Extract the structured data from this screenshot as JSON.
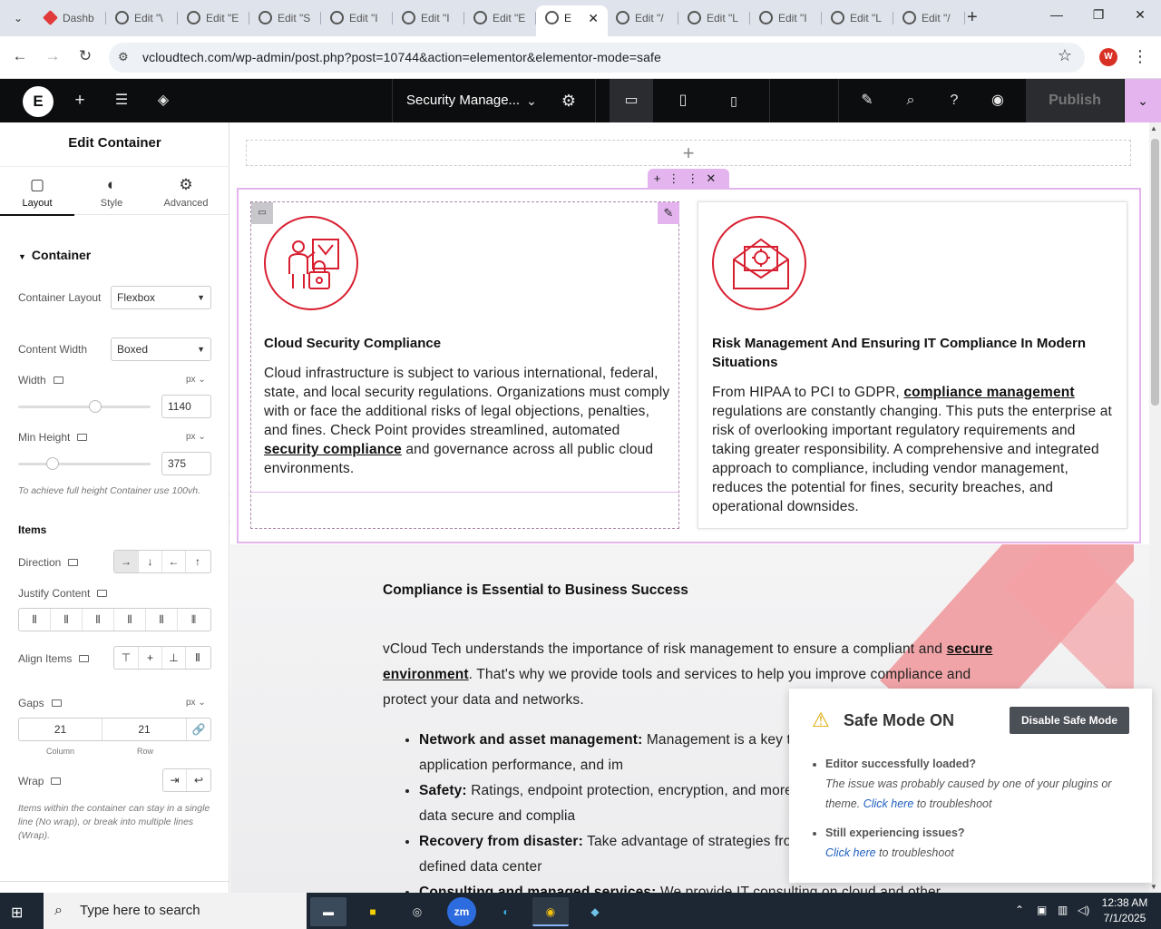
{
  "browser": {
    "tabs": [
      {
        "label": "Dashb",
        "icon": "wordpress-ruby-icon"
      },
      {
        "label": "Edit \"\\",
        "icon": "wordpress-icon"
      },
      {
        "label": "Edit \"E",
        "icon": "wordpress-icon"
      },
      {
        "label": "Edit \"S",
        "icon": "wordpress-icon"
      },
      {
        "label": "Edit \"I",
        "icon": "wordpress-icon"
      },
      {
        "label": "Edit \"I",
        "icon": "wordpress-icon"
      },
      {
        "label": "Edit \"E",
        "icon": "wordpress-icon"
      },
      {
        "label": "E",
        "icon": "wordpress-icon",
        "active": true
      },
      {
        "label": "Edit \"/",
        "icon": "wordpress-icon"
      },
      {
        "label": "Edit \"L",
        "icon": "wordpress-icon"
      },
      {
        "label": "Edit \"I",
        "icon": "wordpress-icon"
      },
      {
        "label": "Edit \"L",
        "icon": "wordpress-icon"
      },
      {
        "label": "Edit \"/",
        "icon": "wordpress-icon"
      }
    ],
    "url": "vcloudtech.com/wp-admin/post.php?post=10744&action=elementor&elementor-mode=safe",
    "profile_initial": "W"
  },
  "elementor": {
    "page_title": "Security Manage...",
    "publish_label": "Publish"
  },
  "panel": {
    "title": "Edit Container",
    "tabs": {
      "layout": "Layout",
      "style": "Style",
      "advanced": "Advanced"
    },
    "section": "Container",
    "container_layout": {
      "label": "Container Layout",
      "value": "Flexbox"
    },
    "content_width": {
      "label": "Content Width",
      "value": "Boxed"
    },
    "width": {
      "label": "Width",
      "unit": "px",
      "value": "1140"
    },
    "min_height": {
      "label": "Min Height",
      "unit": "px",
      "value": "375"
    },
    "min_height_hint": "To achieve full height Container use 100vh.",
    "items_heading": "Items",
    "direction_label": "Direction",
    "justify_label": "Justify Content",
    "align_label": "Align Items",
    "gaps": {
      "label": "Gaps",
      "unit": "px",
      "column": "21",
      "row": "21",
      "column_label": "Column",
      "row_label": "Row"
    },
    "wrap_label": "Wrap",
    "wrap_hint": "Items within the container can stay in a single line (No wrap), or break into multiple lines (Wrap)."
  },
  "canvas": {
    "card1": {
      "title": "Cloud Security Compliance",
      "text_before": "Cloud infrastructure is subject to various international, federal, state, and local security regulations. Organizations must comply with or face the additional risks of legal objections, penalties, and fines. Check Point provides streamlined, automated ",
      "link": "security compliance",
      "text_after": " and governance across all public cloud environments."
    },
    "card2": {
      "title": "Risk Management And Ensuring IT Compliance In Modern Situations",
      "text_before": "From HIPAA to PCI to GDPR, ",
      "link": "compliance management",
      "text_after": " regulations are constantly changing. This puts the enterprise at risk of overlooking important regulatory requirements and taking greater responsibility. A comprehensive and integrated approach to compliance, including vendor management, reduces the potential for fines, security breaches, and operational downsides."
    },
    "heading": "Compliance is Essential to Business Success",
    "para_before": "vCloud Tech understands the importance of risk management to ensure a compliant and ",
    "para_link": "secure environment",
    "para_after": ". That's why we provide tools and services to help you improve compliance and protect your data and networks.",
    "bullets": [
      {
        "bold": "Network and asset management:",
        "text": " Management is a key to securing networks, improving application performance, and im"
      },
      {
        "bold": "Safety:",
        "text": " Ratings, endpoint protection, encryption, and more keep your business and customer data secure and complia"
      },
      {
        "bold": "Recovery from disaster:",
        "text": " Take advantage of strategies from server virtualization to software-defined data center"
      },
      {
        "bold": "Consulting and managed services:",
        "text": " We provide IT consulting on cloud and other"
      }
    ]
  },
  "safe_mode": {
    "title": "Safe Mode ON",
    "button": "Disable Safe Mode",
    "item1_title": "Editor successfully loaded?",
    "item1_text": "The issue was probably caused by one of your plugins or theme.",
    "item1_link": "Click here",
    "item1_tail": " to troubleshoot",
    "item2_title": "Still experiencing issues?",
    "item2_link": "Click here",
    "item2_tail": " to troubleshoot"
  },
  "taskbar": {
    "search_placeholder": "Type here to search",
    "time": "12:38 AM",
    "date": "7/1/2025"
  }
}
